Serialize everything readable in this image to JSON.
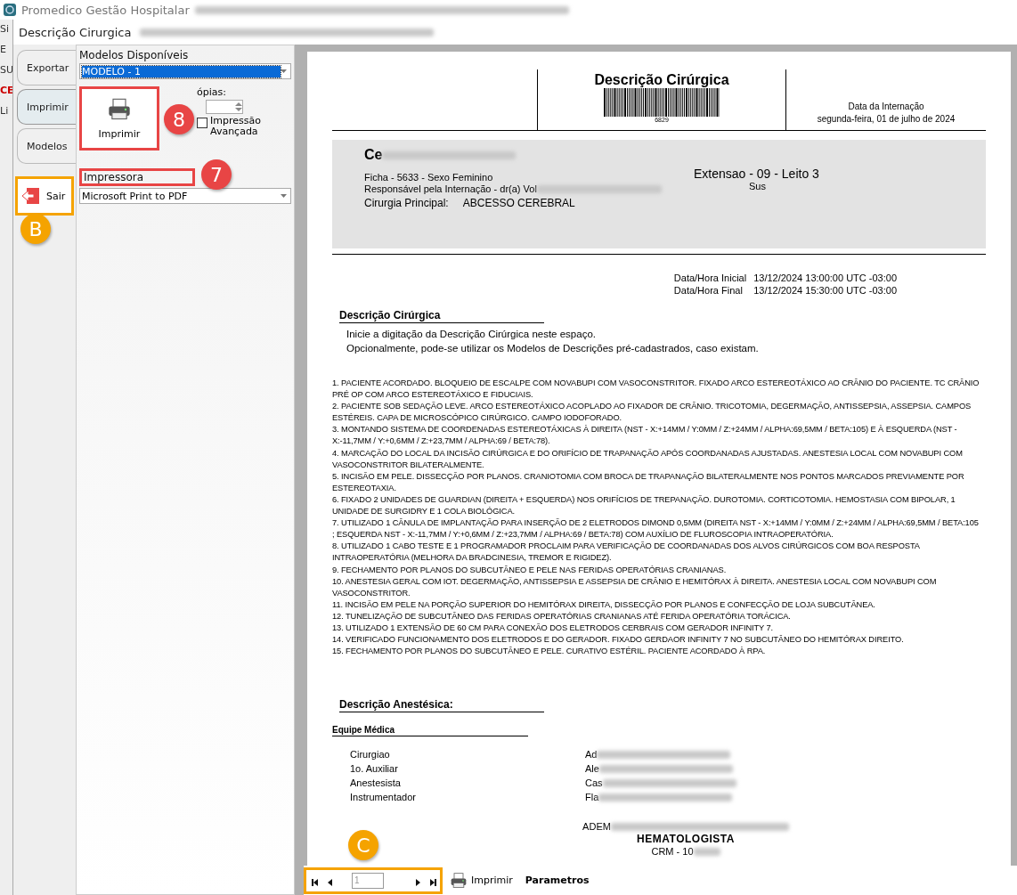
{
  "app": {
    "title": "Promedico Gestão Hospitalar",
    "menu_fragment": "Si",
    "fragments": [
      "E",
      "SU",
      "CE",
      "Li"
    ]
  },
  "dialog": {
    "title": "Descrição Cirurgica"
  },
  "side_tabs": [
    {
      "label": "Exportar",
      "selected": false
    },
    {
      "label": "Imprimir",
      "selected": true
    },
    {
      "label": "Modelos",
      "selected": false
    }
  ],
  "exit_button": {
    "label": "Sair",
    "marker": "B"
  },
  "print_panel": {
    "models_label": "Modelos Disponíveis",
    "model_value": "MODELO - 1",
    "print_button": "Imprimir",
    "print_marker": "8",
    "copies_label": "ópias:",
    "advanced_print": {
      "label": "Impressão Avançada",
      "checked": false
    },
    "printer_label": "Impressora",
    "printer_value": "Microsoft Print to PDF",
    "printer_marker": "7"
  },
  "report": {
    "title": "Descrição Cirúrgica",
    "barcode_number": "6829",
    "admission_label": "Data da Internação",
    "admission_date": "segunda-feira, 01 de julho de 2024",
    "patient": {
      "name": "Ce",
      "record": "Ficha - 5633 - Sexo Feminino",
      "responsible": "Responsável pela Internação - dr(a) Vol",
      "surgery_label": "Cirurgia Principal:",
      "surgery": "ABCESSO CEREBRAL",
      "location": "Extensao - 09 - Leito 3",
      "plan": "Sus"
    },
    "times": [
      {
        "label": "Data/Hora Inicial",
        "value": "13/12/2024 13:00:00 UTC -03:00"
      },
      {
        "label": "Data/Hora Final",
        "value": "13/12/2024 15:30:00 UTC -03:00"
      }
    ],
    "section_title": "Descrição Cirúrgica",
    "intro": [
      "Inicie a digitação da Descrição Cirúrgica neste espaço.",
      "Opcionalmente, pode-se utilizar os Modelos de Descrições pré-cadastrados, caso existam."
    ],
    "items": [
      "1. PACIENTE ACORDADO. BLOQUEIO DE ESCALPE COM NOVABUPI COM VASOCONSTRITOR. FIXADO ARCO ESTEREOTÁXICO AO CRÂNIO DO PACIENTE. TC CRÂNIO PRÉ OP COM ARCO ESTEREOTÁXICO E FIDUCIAIS.",
      "2. PACIENTE SOB SEDAÇÃO LEVE. ARCO ESTEREOTÁXICO ACOPLADO AO FIXADOR DE CRÂNIO. TRICOTOMIA, DEGERMAÇÃO, ANTISSEPSIA, ASSEPSIA. CAMPOS ESTÉREIS. CAPA DE MICROSCÓPICO CIRÚRGICO. CAMPO IODOFORADO.",
      "3. MONTANDO SISTEMA DE COORDENADAS ESTEREOTÁXICAS À DIREITA (NST - X:+14MM / Y:0MM / Z:+24MM / ALPHA:69,5MM / BETA:105) E À ESQUERDA (NST - X:-11,7MM / Y:+0,6MM / Z:+23,7MM / ALPHA:69 / BETA:78).",
      "4. MARCAÇÃO DO LOCAL DA INCISÃO CIRÚRGICA E DO ORIFÍCIO DE TRAPANAÇÃO APÓS COORDANADAS AJUSTADAS. ANESTESIA LOCAL COM NOVABUPI COM VASOCONSTRITOR BILATERALMENTE.",
      "5. INCISÃO EM PELE. DISSECÇÃO POR PLANOS. CRANIOTOMIA COM BROCA DE TRAPANAÇÃO BILATERALMENTE NOS PONTOS MARCADOS PREVIAMENTE POR ESTEREOTAXIA.",
      "6. FIXADO 2 UNIDADES DE GUARDIAN (DIREITA + ESQUERDA) NOS ORIFÍCIOS DE TREPANAÇÃO. DUROTOMIA. CORTICOTOMIA. HEMOSTASIA COM BIPOLAR, 1 UNIDADE DE SURGIDRY E 1 COLA BIOLÓGICA.",
      "7. UTILIZADO 1 CÂNULA DE IMPLANTAÇÃO PARA INSERÇÃO DE 2 ELETRODOS DIMOND 0,5MM (DIREITA NST - X:+14MM / Y:0MM / Z:+24MM / ALPHA:69,5MM / BETA:105 ; ESQUERDA NST - X:-11,7MM / Y:+0,6MM / Z:+23,7MM / ALPHA:69 / BETA:78) COM AUXÍLIO DE FLUROSCOPIA INTRAOPERATÓRIA.",
      "8. UTILIZADO 1 CABO TESTE E 1 PROGRAMADOR PROCLAIM PARA VERIFICAÇÃO DE COORDANADAS DOS ALVOS CIRÚRGICOS COM BOA RESPOSTA INTRAOPERATÓRIA (MELHORA DA BRADCINESIA, TREMOR E RIGIDEZ).",
      "9. FECHAMENTO POR PLANOS DO SUBCUTÂNEO E PELE NAS FERIDAS OPERATÓRIAS CRANIANAS.",
      "10. ANESTESIA GERAL COM IOT. DEGERMAÇÃO, ANTISSEPSIA E ASSEPSIA DE CRÂNIO E HEMITÓRAX À DIREITA. ANESTESIA LOCAL COM NOVABUPI COM VASOCONSTRITOR.",
      "11. INCISÃO EM PELE NA PORÇÃO SUPERIOR DO HEMITÓRAX DIREITA, DISSECÇÃO POR PLANOS E CONFECÇÃO DE LOJA SUBCUTÂNEA.",
      "12. TUNELIZAÇÃO DE SUBCUTÂNEO DAS FERIDAS OPERATÓRIAS CRANIANAS ATÉ FERIDA OPERATÓRIA TORÁCICA.",
      "13. UTILIZADO 1 EXTENSÃO DE 60 CM PARA CONEXÃO DOS ELETRODOS CERBRAIS COM GERADOR INFINITY 7.",
      "14. VERIFICADO FUNCIONAMENTO DOS ELETRODOS E DO GERADOR. FIXADO GERDAOR INFINITY 7 NO SUBCUTÂNEO DO HEMITÓRAX DIREITO.",
      "15. FECHAMENTO POR PLANOS DO SUBCUTÂNEO E PELE. CURATIVO ESTÉRIL. PACIENTE ACORDADO À RPA."
    ],
    "anesthesia_title": "Descrição Anestésica:",
    "team_title": "Equipe Médica",
    "team": [
      {
        "role": "Cirurgiao",
        "name": "Ad"
      },
      {
        "role": "1o. Auxiliar",
        "name": "Ale"
      },
      {
        "role": "Anestesista",
        "name": "Cas"
      },
      {
        "role": "Instrumentador",
        "name": "Fla"
      }
    ],
    "signature": {
      "name": "ADEM",
      "specialty": "HEMATOLOGISTA",
      "crm": "CRM - 10"
    }
  },
  "toolbar": {
    "page": "1",
    "print": "Imprimir",
    "params": "Parametros",
    "marker": "C"
  }
}
